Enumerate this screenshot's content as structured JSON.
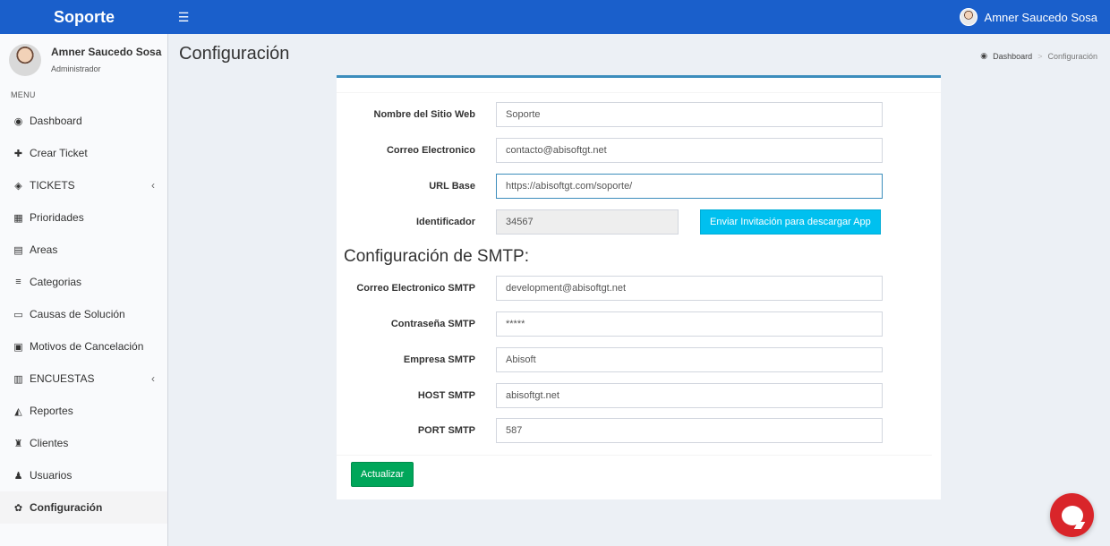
{
  "header": {
    "brand": "Soporte",
    "menu_toggle_icon": "hamburger-icon",
    "user_name": "Amner Saucedo Sosa"
  },
  "sidebar": {
    "user_name": "Amner Saucedo Sosa",
    "user_role": "Administrador",
    "menu_header": "MENU",
    "items": [
      {
        "label": "Dashboard",
        "icon": "dashboard-icon",
        "glyph": "◉"
      },
      {
        "label": "Crear Ticket",
        "icon": "plus-icon",
        "glyph": "✚"
      },
      {
        "label": "TICKETS",
        "icon": "ticket-icon",
        "glyph": "◈",
        "chevron": "‹"
      },
      {
        "label": "Prioridades",
        "icon": "grid-icon",
        "glyph": "▦"
      },
      {
        "label": "Areas",
        "icon": "list-icon",
        "glyph": "▤"
      },
      {
        "label": "Categorias",
        "icon": "bars-icon",
        "glyph": "≡"
      },
      {
        "label": "Causas de Solución",
        "icon": "folder-icon",
        "glyph": "▭"
      },
      {
        "label": "Motivos de Cancelación",
        "icon": "card-icon",
        "glyph": "▣"
      },
      {
        "label": "ENCUESTAS",
        "icon": "calendar-icon",
        "glyph": "▥",
        "chevron": "‹"
      },
      {
        "label": "Reportes",
        "icon": "area-chart-icon",
        "glyph": "◭"
      },
      {
        "label": "Clientes",
        "icon": "user-tie-icon",
        "glyph": "♜"
      },
      {
        "label": "Usuarios",
        "icon": "users-icon",
        "glyph": "♟"
      },
      {
        "label": "Configuración",
        "icon": "gear-icon",
        "glyph": "✿"
      }
    ],
    "active_index": 12
  },
  "page": {
    "title": "Configuración",
    "breadcrumb": {
      "home": "Dashboard",
      "current": "Configuración",
      "separator": ">"
    }
  },
  "form": {
    "site_name": {
      "label": "Nombre del Sitio Web",
      "value": "Soporte"
    },
    "email": {
      "label": "Correo Electronico",
      "value": "contacto@abisoftgt.net"
    },
    "base_url": {
      "label": "URL Base",
      "value": "https://abisoftgt.com/soporte/"
    },
    "identifier": {
      "label": "Identificador",
      "value": "34567"
    },
    "invite_button": "Enviar Invitación para descargar App",
    "smtp_title": "Configuración de SMTP:",
    "smtp_email": {
      "label": "Correo Electronico SMTP",
      "value": "development@abisoftgt.net"
    },
    "smtp_password": {
      "label": "Contraseña SMTP",
      "value": "*****"
    },
    "smtp_company": {
      "label": "Empresa SMTP",
      "value": "Abisoft"
    },
    "smtp_host": {
      "label": "HOST SMTP",
      "value": "abisoftgt.net"
    },
    "smtp_port": {
      "label": "PORT SMTP",
      "value": "587"
    },
    "save_button": "Actualizar"
  },
  "colors": {
    "header": "#1a5fcb",
    "box_accent": "#3c8dbc",
    "invite_button": "#00c0ef",
    "save_button": "#00a65a",
    "chat_widget": "#d9252a"
  },
  "chat_widget_icon": "chat-bubble-icon"
}
